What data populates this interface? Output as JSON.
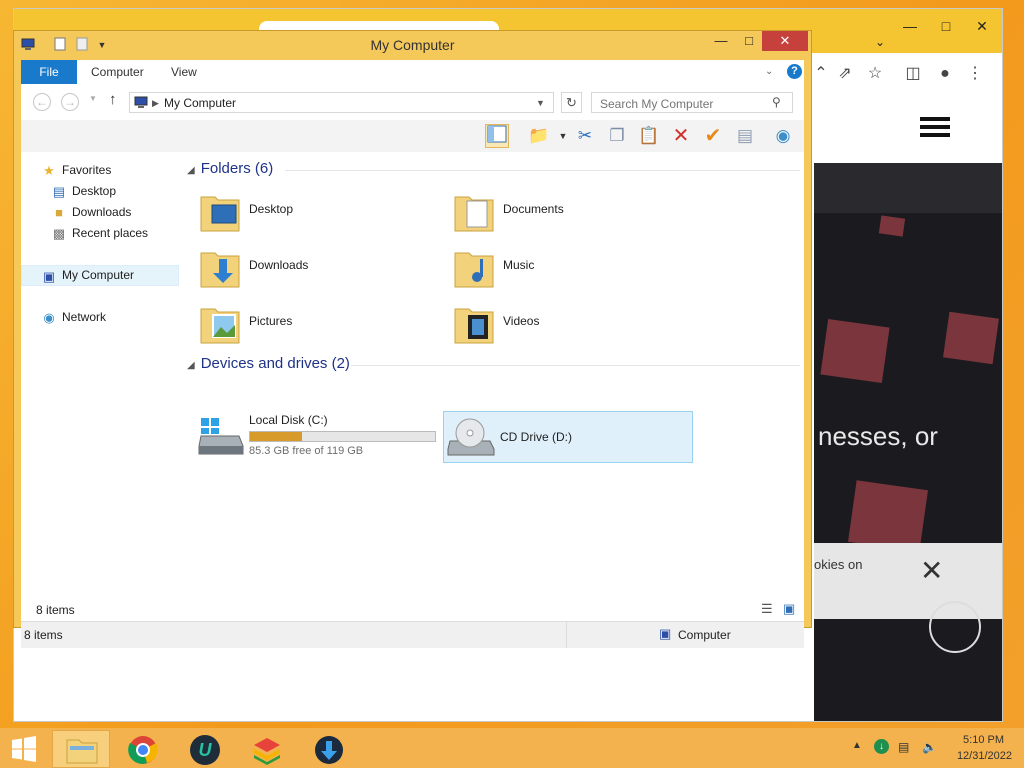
{
  "explorer": {
    "title": "My Computer",
    "ribbon_tabs": [
      "File",
      "Computer",
      "View"
    ],
    "address": "My Computer",
    "search_placeholder": "Search My Computer",
    "nav": {
      "favorites": "Favorites",
      "desktop": "Desktop",
      "downloads": "Downloads",
      "recent": "Recent places",
      "computer": "My Computer",
      "network": "Network"
    },
    "folders_header": "Folders (6)",
    "folders": [
      "Desktop",
      "Documents",
      "Downloads",
      "Music",
      "Pictures",
      "Videos"
    ],
    "devices_header": "Devices and drives (2)",
    "drives": [
      {
        "name": "Local Disk (C:)",
        "free": "85.3 GB free of 119 GB",
        "used_fraction": 0.283
      },
      {
        "name": "CD Drive (D:)"
      }
    ],
    "item_count": "8 items",
    "status_items": "8 items",
    "status_location": "Computer"
  },
  "browser": {
    "page_text": "nesses, or",
    "cookie_text": "okies on"
  },
  "taskbar": {
    "time": "5:10 PM",
    "date": "12/31/2022"
  },
  "colors": {
    "file_tab": "#1979ca",
    "selection": "#dff0fa",
    "window_frame": "#f5c85a",
    "disk_bar": "#d69b2b"
  }
}
